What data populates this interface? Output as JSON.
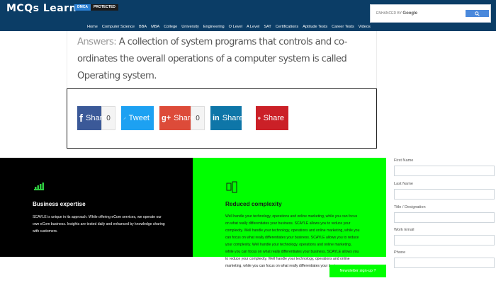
{
  "header": {
    "logo": "MCQs Learn",
    "badge_dmca": "DMCA",
    "badge_protected": "PROTECTED",
    "search_prefix": "ENHANCED BY",
    "search_brand": "Google"
  },
  "nav": {
    "items": [
      "Home",
      "Computer Science",
      "BBA",
      "MBA",
      "College",
      "University",
      "Engineering",
      "O Level",
      "A Level",
      "SAT",
      "Certifications",
      "Aptitude Tests",
      "Career Tests",
      "Videos"
    ]
  },
  "article": {
    "answer_label": "Answers:",
    "answer_text": "A collection of system programs that controls and co-ordinates the overall operations of a computer system is called Operating system."
  },
  "share": {
    "facebook": {
      "icon": "f",
      "label": "Share",
      "count": "0"
    },
    "twitter": {
      "label": "Tweet"
    },
    "googleplus": {
      "icon": "g+",
      "label": "Share",
      "count": "0"
    },
    "linkedin": {
      "icon": "in",
      "label": "Share"
    },
    "pinterest": {
      "label": "Share"
    }
  },
  "features": {
    "business": {
      "title": "Business expertise",
      "text": "SCAYLE is unique in its approach. While offering eCom services, we operate our own eCom business. Insights are tested daily and enhanced by knowledge sharing with customers."
    },
    "complexity": {
      "title": "Reduced complexity",
      "text": "Well handle your technology, operations and online marketing, while you can focus on what really differentiates your business. SCAYLE allows you to reduce your complexity. Well handle your technology, operations and online marketing, while you can focus on what really differentiates your business. SCAYLE allows you to reduce your complexity. Well handle your technology, operations and online marketing, while you can focus on what really differentiates your business. SCAYLE allows you to reduce your complexity. Well handle your technology, operations and online marketing, while you can focus on what really differentiates your business."
    }
  },
  "form": {
    "first_name": "First Name",
    "last_name": "Last Name",
    "title": "Title / Designation",
    "email": "Work Email",
    "phone": "Phone",
    "newsletter_button": "Newsletter sign-up ?"
  },
  "colors": {
    "header_bg": "#0b3d66",
    "feature_green": "#00ff00",
    "feature_black": "#000000"
  }
}
